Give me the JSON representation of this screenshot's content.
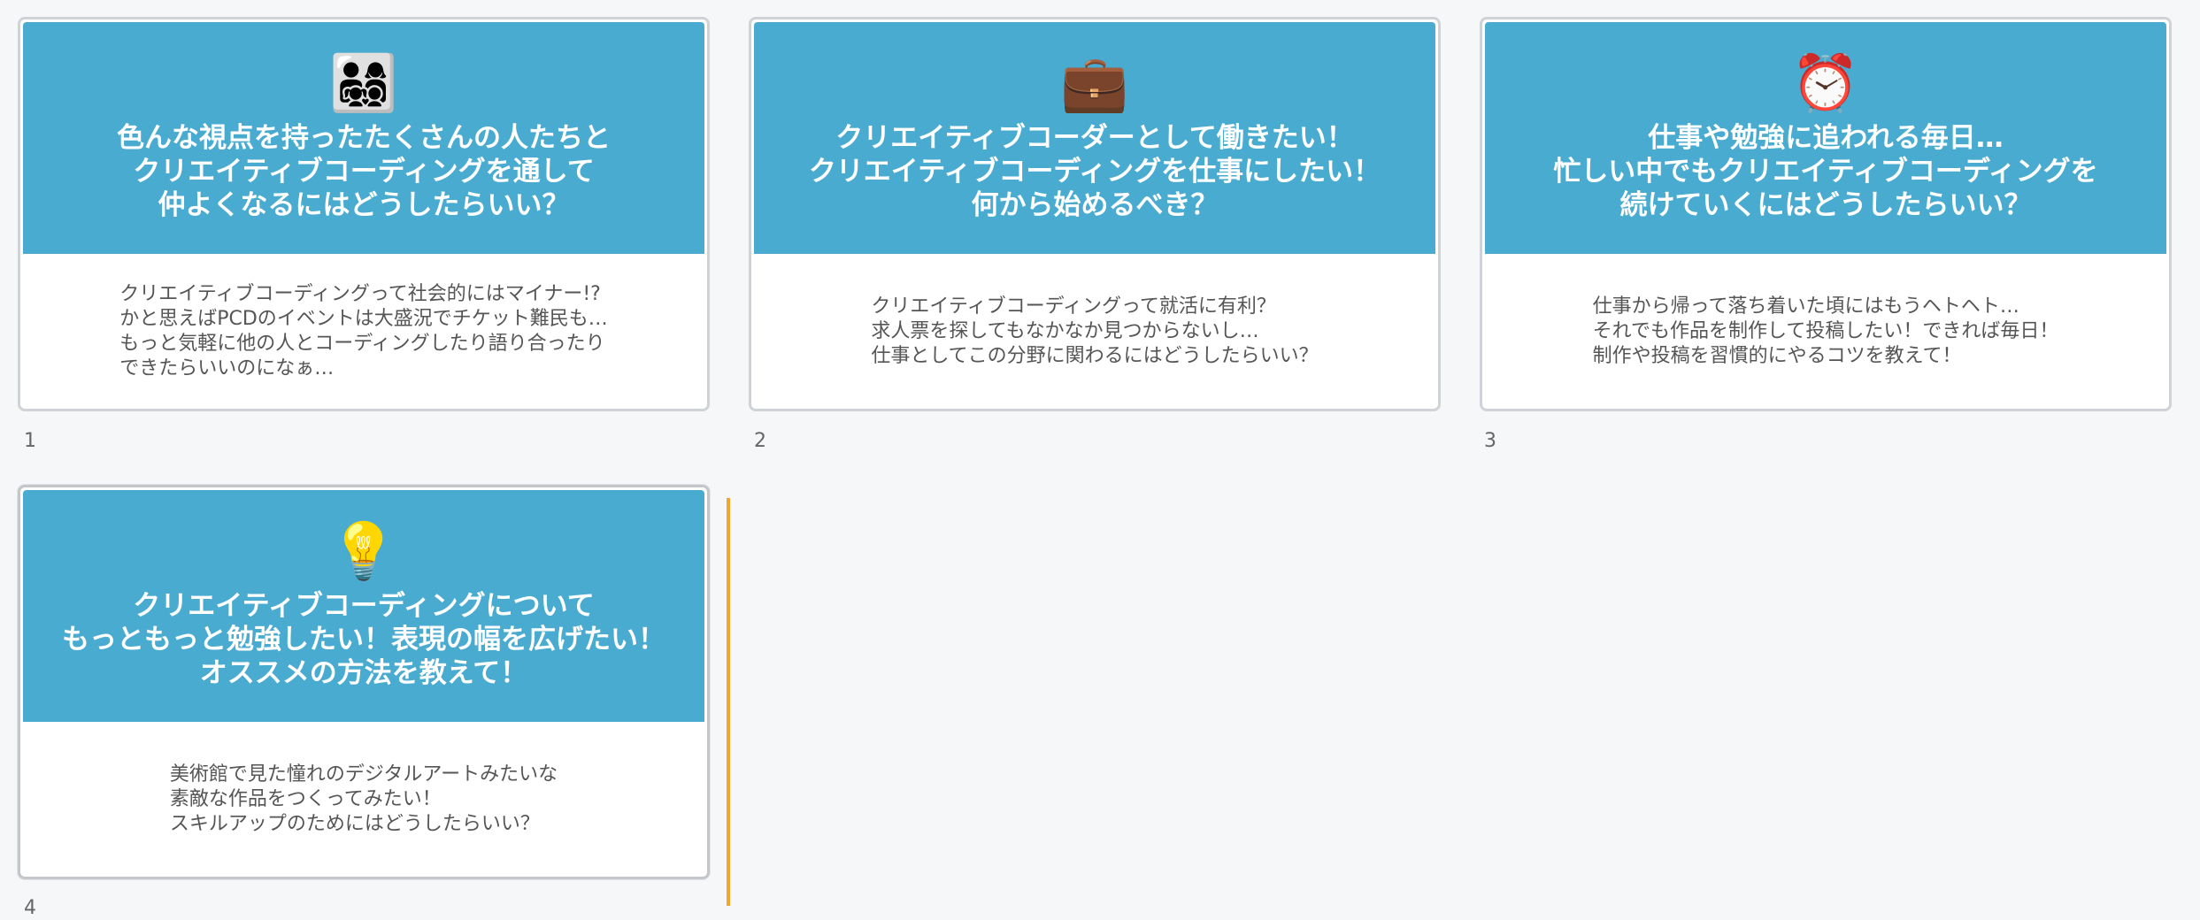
{
  "slides": [
    {
      "number": "1",
      "icon": "family-emoji-icon",
      "emoji": "👨‍👩‍👧‍👦",
      "title": "色んな視点を持ったたくさんの人たちと\nクリエイティブコーディングを通して\n仲よくなるにはどうしたらいい？",
      "body": "クリエイティブコーディングって社会的にはマイナー!?\nかと思えばPCDのイベントは大盛況でチケット難民も…\nもっと気軽に他の人とコーディングしたり語り合ったり\nできたらいいのになぁ…"
    },
    {
      "number": "2",
      "icon": "briefcase-emoji-icon",
      "emoji": "💼",
      "title": "クリエイティブコーダーとして働きたい！\nクリエイティブコーディングを仕事にしたい！\n何から始めるべき？",
      "body": "クリエイティブコーディングって就活に有利？\n求人票を探してもなかなか見つからないし…\n仕事としてこの分野に関わるにはどうしたらいい？"
    },
    {
      "number": "3",
      "icon": "alarm-clock-emoji-icon",
      "emoji": "⏰",
      "title": "仕事や勉強に追われる毎日…\n忙しい中でもクリエイティブコーディングを\n続けていくにはどうしたらいい？",
      "body": "仕事から帰って落ち着いた頃にはもうヘトヘト…\nそれでも作品を制作して投稿したい！できれば毎日！\n制作や投稿を習慣的にやるコツを教えて！"
    },
    {
      "number": "4",
      "icon": "light-bulb-emoji-icon",
      "emoji": "💡",
      "title": "クリエイティブコーディングについて\nもっともっと勉強したい！表現の幅を広げたい！\nオススメの方法を教えて！",
      "body": "美術館で見た憧れのデジタルアートみたいな\n素敵な作品をつくってみたい！\nスキルアップのためにはどうしたらいい？"
    }
  ],
  "colors": {
    "header_bg": "#4aabd0",
    "insert_marker": "#f3a72a",
    "page_bg": "#f6f7f9"
  }
}
